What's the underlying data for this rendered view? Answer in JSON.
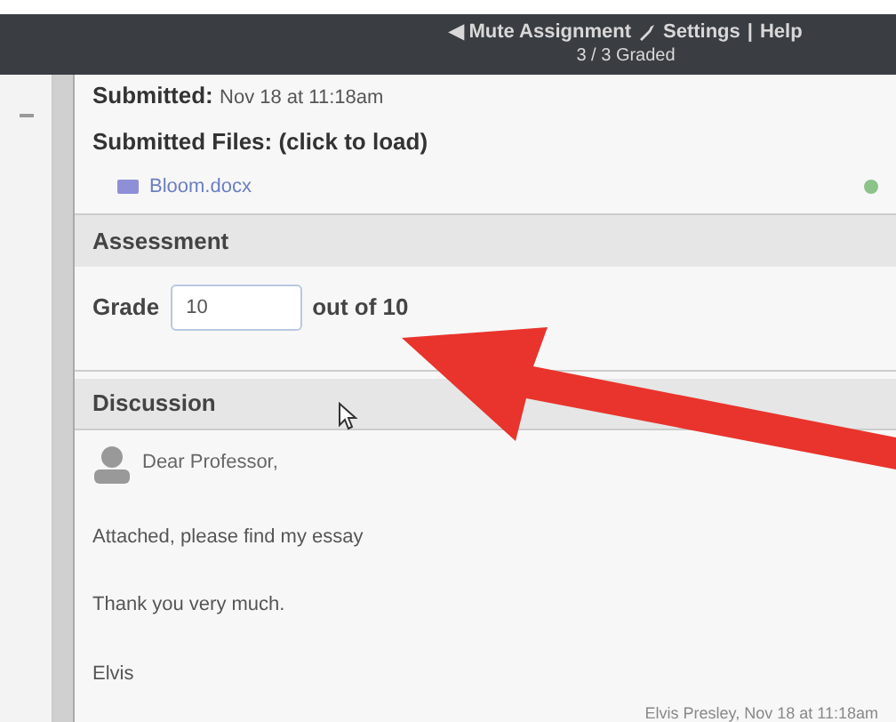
{
  "header": {
    "mute": "◀ Mute Assignment",
    "settings": "Settings",
    "separator": "|",
    "help": "Help",
    "graded": "3 / 3 Graded"
  },
  "submission": {
    "submitted_label": "Submitted:",
    "submitted_value": "Nov 18 at 11:18am",
    "files_label": "Submitted Files: (click to load)",
    "file": "Bloom.docx"
  },
  "assessment": {
    "title": "Assessment",
    "grade_label": "Grade",
    "grade_value": "10",
    "out_of": "out of 10"
  },
  "discussion": {
    "title": "Discussion",
    "greeting": "Dear Professor,",
    "paragraphs": [
      "Attached, please find my essay",
      "Thank you very much.",
      "Elvis"
    ],
    "footer": "Elvis Presley, Nov 18 at 11:18am"
  }
}
